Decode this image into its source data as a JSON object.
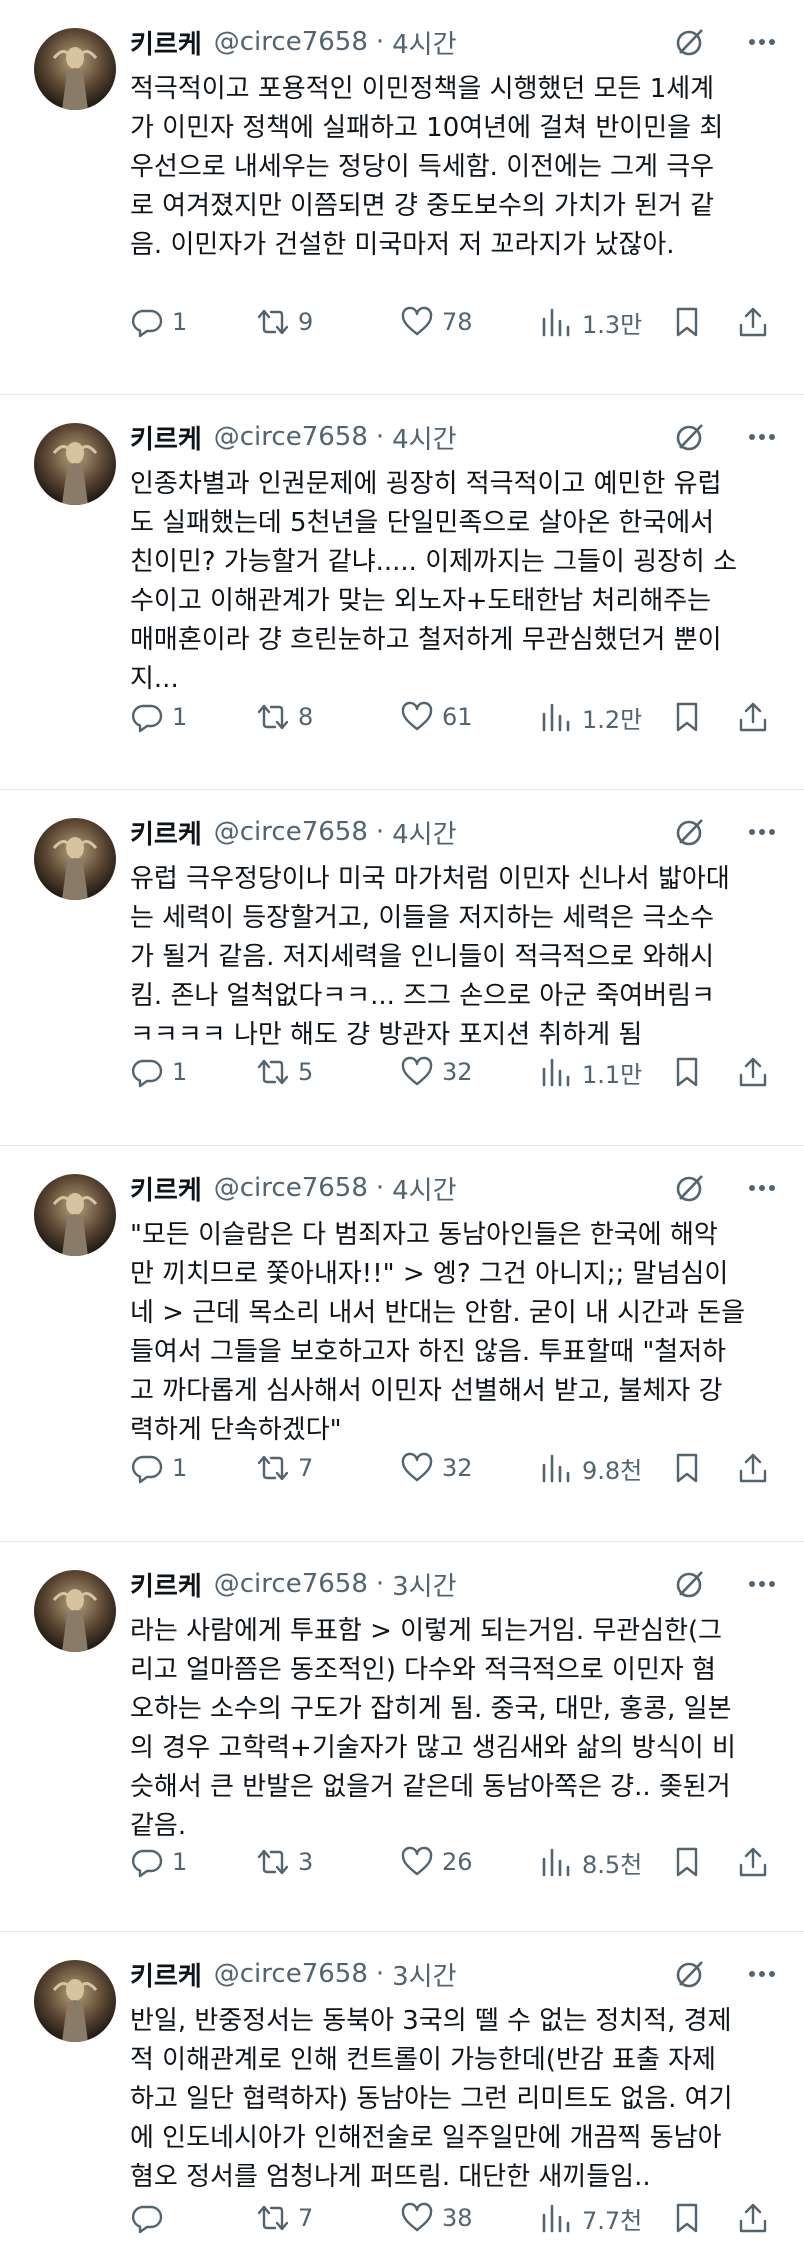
{
  "tweets": [
    {
      "name": "키르케",
      "handle": "@circe7658",
      "dot": "·",
      "time": "4시간",
      "lines": [
        "적극적이고 포용적인 이민정책을 시행했던 모든 1세계",
        "가 이민자 정책에 실패하고 10여년에 걸쳐 반이민을 최",
        "우선으로 내세우는 정당이 득세함. 이전에는 그게 극우",
        "로 여겨졌지만 이쯤되면 걍 중도보수의 가치가 된거 같",
        "음. 이민자가 건설한 미국마저 저 꼬라지가 났잖아."
      ],
      "replies": "1",
      "retweets": "9",
      "likes": "78",
      "views": "1.3만"
    },
    {
      "name": "키르케",
      "handle": "@circe7658",
      "dot": "·",
      "time": "4시간",
      "lines": [
        "인종차별과 인권문제에 굉장히 적극적이고 예민한 유럽",
        "도 실패했는데 5천년을 단일민족으로 살아온 한국에서",
        "친이민? 가능할거 같냐..... 이제까지는 그들이 굉장히 소",
        "수이고 이해관계가 맞는 외노자+도태한남 처리해주는",
        "매매혼이라 걍 흐린눈하고 철저하게 무관심했던거 뿐이",
        "지..."
      ],
      "replies": "1",
      "retweets": "8",
      "likes": "61",
      "views": "1.2만"
    },
    {
      "name": "키르케",
      "handle": "@circe7658",
      "dot": "·",
      "time": "4시간",
      "lines": [
        "유럽 극우정당이나 미국 마가처럼 이민자 신나서 밟아대",
        "는 세력이 등장할거고, 이들을 저지하는 세력은 극소수",
        "가 될거 같음. 저지세력을 인니들이 적극적으로 와해시",
        "킴. 존나 얼척없다ㅋㅋ... 즈그 손으로 아군 죽여버림ㅋ",
        "ㅋㅋㅋㅋ 나만 해도 걍 방관자 포지션 취하게 됨"
      ],
      "replies": "1",
      "retweets": "5",
      "likes": "32",
      "views": "1.1만"
    },
    {
      "name": "키르케",
      "handle": "@circe7658",
      "dot": "·",
      "time": "4시간",
      "lines": [
        "\"모든 이슬람은 다 범죄자고 동남아인들은 한국에 해악",
        "만 끼치므로 쫓아내자!!\" > 엥? 그건 아니지;; 말넘심이",
        "네 > 근데 목소리 내서 반대는 안함. 굳이 내 시간과 돈을",
        "들여서 그들을 보호하고자 하진 않음. 투표할때 \"철저하",
        "고 까다롭게 심사해서 이민자 선별해서 받고, 불체자 강",
        "력하게 단속하겠다\""
      ],
      "replies": "1",
      "retweets": "7",
      "likes": "32",
      "views": "9.8천"
    },
    {
      "name": "키르케",
      "handle": "@circe7658",
      "dot": "·",
      "time": "3시간",
      "lines": [
        "라는 사람에게 투표함 > 이렇게 되는거임. 무관심한(그",
        "리고 얼마쯤은 동조적인) 다수와 적극적으로 이민자 혐",
        "오하는 소수의 구도가 잡히게 됨. 중국, 대만, 홍콩, 일본",
        "의 경우 고학력+기술자가 많고 생김새와 삶의 방식이 비",
        "슷해서 큰 반발은 없을거 같은데 동남아쪽은 걍.. 좆된거",
        "같음."
      ],
      "replies": "1",
      "retweets": "3",
      "likes": "26",
      "views": "8.5천"
    },
    {
      "name": "키르케",
      "handle": "@circe7658",
      "dot": "·",
      "time": "3시간",
      "lines": [
        "반일, 반중정서는 동북아 3국의 뗄 수 없는 정치적, 경제",
        "적 이해관계로 인해 컨트롤이 가능한데(반감 표출 자제",
        "하고 일단 협력하자) 동남아는 그런 리미트도 없음. 여기",
        "에 인도네시아가 인해전술로 일주일만에 개끔찍 동남아",
        "혐오 정서를 엄청나게 퍼뜨림. 대단한 새끼들임.."
      ],
      "replies": "",
      "retweets": "7",
      "likes": "38",
      "views": "7.7천"
    }
  ],
  "icons": {
    "grok": "grok-icon",
    "more": "more-icon",
    "reply": "reply-icon",
    "retweet": "retweet-icon",
    "like": "heart-icon",
    "views": "views-icon",
    "bookmark": "bookmark-icon",
    "share": "share-icon"
  },
  "colors": {
    "text": "#0f1419",
    "secondary": "#536471",
    "divider": "#e6e9ec"
  }
}
